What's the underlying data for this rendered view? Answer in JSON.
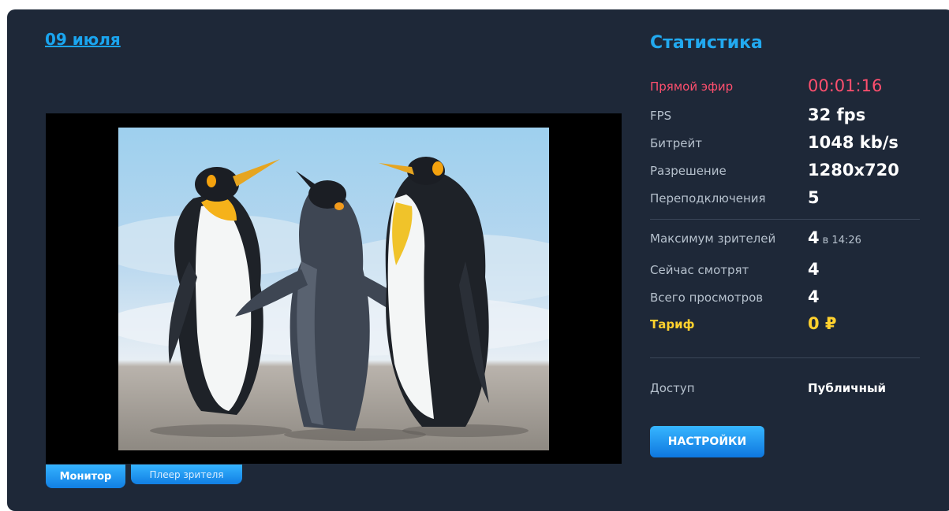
{
  "header": {
    "date_link": "09 июля"
  },
  "player": {
    "tabs": {
      "monitor": "Монитор",
      "viewer": "Плеер зрителя"
    }
  },
  "stats": {
    "title": "Статистика",
    "live": {
      "label": "Прямой эфир",
      "value": "00:01:16"
    },
    "fps": {
      "label": "FPS",
      "value": "32 fps"
    },
    "bitrate": {
      "label": "Битрейт",
      "value": "1048 kb/s"
    },
    "resolution": {
      "label": "Разрешение",
      "value": "1280x720"
    },
    "reconnects": {
      "label": "Переподключения",
      "value": "5"
    },
    "max_viewers": {
      "label": "Максимум зрителей",
      "value": "4",
      "note": "в 14:26"
    },
    "watching_now": {
      "label": "Сейчас смотрят",
      "value": "4"
    },
    "total_views": {
      "label": "Всего просмотров",
      "value": "4"
    },
    "tariff": {
      "label": "Тариф",
      "value": "0 ₽"
    },
    "access": {
      "label": "Доступ",
      "value": "Публичный"
    },
    "settings_button": "НАСТРОЙКИ"
  },
  "colors": {
    "panel_bg": "#1e2838",
    "accent": "#22a9ef",
    "live": "#ff4f6e",
    "tariff": "#ffd12e",
    "button": "#1a8ff0"
  }
}
